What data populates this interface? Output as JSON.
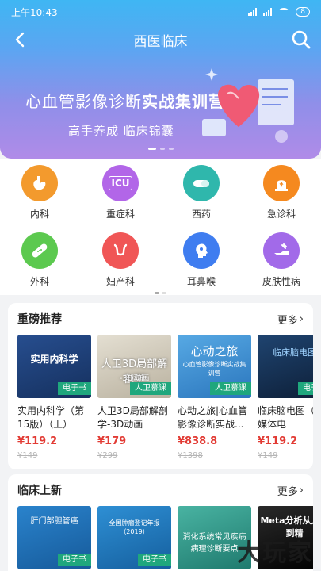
{
  "status": {
    "time": "上午10:43",
    "battery": "8"
  },
  "nav": {
    "title": "西医临床"
  },
  "banner": {
    "title_plain": "心血管影像诊断",
    "title_bold": "实战集训营",
    "subtitle": "高手养成   临床锦囊"
  },
  "categories": [
    {
      "label": "内科",
      "icon": "stomach-icon",
      "color": "#f39a2d"
    },
    {
      "label": "重症科",
      "icon": "icu-icon",
      "color": "#b266e8",
      "text": "ICU"
    },
    {
      "label": "西药",
      "icon": "pill-icon",
      "color": "#2fb7ac"
    },
    {
      "label": "急诊科",
      "icon": "siren-icon",
      "color": "#f5891f"
    },
    {
      "label": "外科",
      "icon": "bandage-icon",
      "color": "#5cc94f"
    },
    {
      "label": "妇产科",
      "icon": "uterus-icon",
      "color": "#f05656"
    },
    {
      "label": "耳鼻喉",
      "icon": "head-profile-icon",
      "color": "#3f7df0"
    },
    {
      "label": "皮肤性病",
      "icon": "skin-care-icon",
      "color": "#a26ae9"
    }
  ],
  "featured": {
    "title": "重磅推荐",
    "more": "更多",
    "books": [
      {
        "title": "实用内科学（第15版）（上）",
        "price": "¥119.2",
        "orig": "¥149",
        "badge": "电子书",
        "cover_text": "实用内科学",
        "cover_color": "#1f3f7a"
      },
      {
        "title": "人卫3D局部解剖学-3D动画",
        "price": "¥179",
        "orig": "¥299",
        "badge": "人卫慕课",
        "cover_text": "人卫3D局部解剖学",
        "cover_sub": "-3D动画",
        "cover_color": "#c9c3b3"
      },
      {
        "title": "心动之旅|心血管影像诊断实战...",
        "price": "¥838.8",
        "orig": "¥1398",
        "badge": "人卫慕课",
        "cover_text": "心动之旅",
        "cover_sub": "心血管影像诊断实战集训营",
        "cover_color": "#3b8fd1"
      },
      {
        "title": "临床脑电图（富媒体电",
        "price": "¥119.2",
        "orig": "¥149",
        "badge": "电子书",
        "cover_text": "临床脑电图",
        "cover_color": "#16304f"
      }
    ]
  },
  "latest": {
    "title": "临床上新",
    "more": "更多",
    "books": [
      {
        "cover_text": "肝门部胆管癌",
        "badge": "电子书",
        "cover_color": "#1e6fb8"
      },
      {
        "cover_text": "全国肿瘤登记年报（2019）",
        "badge": "电子书",
        "cover_color": "#1d78b8"
      },
      {
        "cover_text": "消化系统常见疾病病理诊断要点",
        "badge": "",
        "cover_color": "#2e9a8c"
      },
      {
        "cover_text": "Meta分析从入门到精",
        "badge": "",
        "cover_color": "#111"
      }
    ]
  },
  "watermark": "大玩家"
}
